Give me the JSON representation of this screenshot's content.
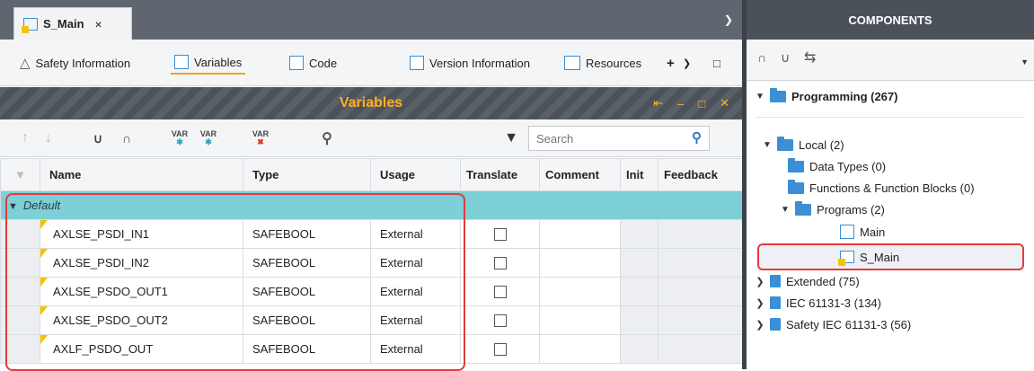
{
  "editor": {
    "tab_label": "S_Main",
    "tab_close": "×",
    "sections": {
      "safety_info": "Safety Information",
      "variables": "Variables",
      "code": "Code",
      "version_info": "Version Information",
      "resources": "Resources"
    },
    "panel_title": "Variables",
    "search_placeholder": "Search",
    "columns": [
      "Name",
      "Type",
      "Usage",
      "Translate",
      "Comment",
      "Init",
      "Feedback"
    ],
    "group_label": "Default",
    "rows": [
      {
        "name": "AXLSE_PSDI_IN1",
        "type": "SAFEBOOL",
        "usage": "External",
        "translate": false
      },
      {
        "name": "AXLSE_PSDI_IN2",
        "type": "SAFEBOOL",
        "usage": "External",
        "translate": false
      },
      {
        "name": "AXLSE_PSDO_OUT1",
        "type": "SAFEBOOL",
        "usage": "External",
        "translate": false
      },
      {
        "name": "AXLSE_PSDO_OUT2",
        "type": "SAFEBOOL",
        "usage": "External",
        "translate": false
      },
      {
        "name": "AXLF_PSDO_OUT",
        "type": "SAFEBOOL",
        "usage": "External",
        "translate": false
      }
    ]
  },
  "components": {
    "title": "COMPONENTS",
    "tree": {
      "programming": "Programming (267)",
      "local": "Local (2)",
      "data_types": "Data Types (0)",
      "functions": "Functions & Function Blocks (0)",
      "programs": "Programs (2)",
      "main": "Main",
      "s_main": "S_Main",
      "extended": "Extended (75)",
      "iec": "IEC 61131-3 (134)",
      "safety_iec": "Safety IEC 61131-3 (56)"
    }
  },
  "colors": {
    "accent": "#f0a21a",
    "group_row": "#7dcfd8",
    "highlight": "#e23b3b",
    "folder": "#3a8fd6"
  }
}
